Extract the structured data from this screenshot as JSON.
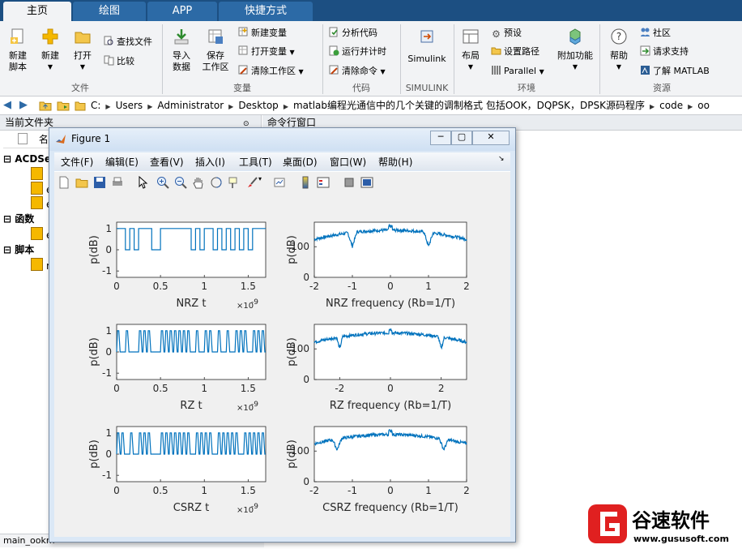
{
  "tabs": [
    {
      "label": "主页",
      "active": true
    },
    {
      "label": "绘图",
      "active": false
    },
    {
      "label": "APP",
      "active": false
    },
    {
      "label": "快捷方式",
      "active": false
    }
  ],
  "ribbon": {
    "new_script": "新建\n脚本",
    "new": "新建",
    "open": "打开",
    "find_files": "查找文件",
    "compare": "比较",
    "import_data": "导入\n数据",
    "save_workspace": "保存\n工作区",
    "new_variable": "新建变量",
    "open_variable": "打开变量",
    "clear_workspace": "清除工作区",
    "analyze_code": "分析代码",
    "run_and_time": "运行并计时",
    "clear_commands": "清除命令",
    "simulink": "Simulink",
    "layout": "布局",
    "preferences": "预设",
    "set_path": "设置路径",
    "parallel": "Parallel",
    "addons": "附加功能",
    "help": "帮助",
    "community": "社区",
    "request_support": "请求支持",
    "learn_matlab": "了解 MATLAB",
    "groups": [
      "文件",
      "变量",
      "代码",
      "SIMULINK",
      "环境",
      "资源"
    ]
  },
  "address": {
    "crumbs": [
      "C:",
      "Users",
      "Administrator",
      "Desktop",
      "matlab编程光通信中的几个关键的调制格式 包括OOK，DQPSK，DPSK源码程序",
      "code",
      "oo"
    ]
  },
  "current_folder": {
    "title": "当前文件夹",
    "name_column": "名",
    "sections": [
      {
        "label": "ACDSe",
        "items": [
          "",
          "e",
          "e"
        ]
      },
      {
        "label": "函数",
        "items": [
          "e"
        ]
      },
      {
        "label": "脚本",
        "items": [
          "m"
        ]
      }
    ],
    "status": "main_ookm"
  },
  "command_window": {
    "title": "命令行窗口"
  },
  "figure": {
    "title": "Figure 1",
    "menus": [
      "文件(F)",
      "编辑(E)",
      "查看(V)",
      "插入(I)",
      "工具(T)",
      "桌面(D)",
      "窗口(W)",
      "帮助(H)"
    ],
    "axes_common": {
      "ylabel": "p(dB)",
      "exponent": "×10",
      "exponent_power": "-9"
    }
  },
  "chart_data": [
    {
      "type": "line",
      "row": 0,
      "col": 0,
      "title": "",
      "xlabel": "NRZ   t",
      "ylabel": "p(dB)",
      "xlim": [
        0,
        1.7
      ],
      "ylim": [
        -1.3,
        1.3
      ],
      "xticks": [
        0,
        0.5,
        1,
        1.5
      ],
      "xtick_labels": [
        "0",
        "0.5",
        "1",
        "1.5"
      ],
      "yticks": [
        -1,
        0,
        1
      ],
      "ytick_labels": [
        "-1",
        "0",
        "1"
      ],
      "exponent": "-9",
      "waveform": {
        "kind": "nrz",
        "bits": [
          1,
          1,
          0,
          1,
          0,
          1,
          1,
          1,
          0,
          0,
          1,
          1,
          1,
          1,
          1,
          1,
          1,
          0,
          1,
          0,
          1,
          1,
          0,
          1,
          0,
          1,
          0,
          1,
          0,
          1,
          0,
          1,
          1,
          1
        ]
      }
    },
    {
      "type": "line",
      "row": 0,
      "col": 1,
      "title": "",
      "xlabel": "NRZ   frequency (Rb=1/T)",
      "ylabel": "p(dB)",
      "xlim": [
        -2,
        2
      ],
      "ylim": [
        0,
        180
      ],
      "xticks": [
        -2,
        -1,
        0,
        1,
        2
      ],
      "xtick_labels": [
        "-2",
        "-1",
        "0",
        "1",
        "2"
      ],
      "yticks": [
        0,
        100
      ],
      "ytick_labels": [
        "0",
        "100"
      ],
      "spectrum": {
        "nulls": [
          -1,
          1
        ],
        "peak": 160,
        "null_depth": 130
      }
    },
    {
      "type": "line",
      "row": 1,
      "col": 0,
      "title": "",
      "xlabel": "RZ   t",
      "ylabel": "p(dB)",
      "xlim": [
        0,
        1.7
      ],
      "ylim": [
        -1.3,
        1.3
      ],
      "xticks": [
        0,
        0.5,
        1,
        1.5
      ],
      "xtick_labels": [
        "0",
        "0.5",
        "1",
        "1.5"
      ],
      "yticks": [
        -1,
        0,
        1
      ],
      "ytick_labels": [
        "-1",
        "0",
        "1"
      ],
      "exponent": "-9",
      "waveform": {
        "kind": "rz",
        "bits": [
          1,
          0,
          1,
          0,
          0,
          1,
          1,
          1,
          0,
          0,
          1,
          1,
          1,
          1,
          1,
          1,
          1,
          0,
          1,
          0,
          1,
          1,
          0,
          1,
          0,
          1,
          0,
          1,
          1,
          1,
          0,
          1,
          1,
          1
        ]
      }
    },
    {
      "type": "line",
      "row": 1,
      "col": 1,
      "title": "",
      "xlabel": "RZ   frequency (Rb=1/T)",
      "ylabel": "p(dB)",
      "xlim": [
        -3,
        3
      ],
      "ylim": [
        0,
        180
      ],
      "xticks": [
        -2,
        0,
        2
      ],
      "xtick_labels": [
        "-2",
        "0",
        "2"
      ],
      "yticks": [
        0,
        100
      ],
      "ytick_labels": [
        "0",
        "100"
      ],
      "spectrum": {
        "nulls": [
          -2,
          2
        ],
        "peak": 158,
        "null_depth": 110
      }
    },
    {
      "type": "line",
      "row": 2,
      "col": 0,
      "title": "",
      "xlabel": "CSRZ   t",
      "ylabel": "p(dB)",
      "xlim": [
        0,
        1.7
      ],
      "ylim": [
        -1.3,
        1.3
      ],
      "xticks": [
        0,
        0.5,
        1,
        1.5
      ],
      "xtick_labels": [
        "0",
        "0.5",
        "1",
        "1.5"
      ],
      "yticks": [
        -1,
        0,
        1
      ],
      "ytick_labels": [
        "-1",
        "0",
        "1"
      ],
      "exponent": "-9",
      "waveform": {
        "kind": "rz",
        "bits": [
          1,
          1,
          0,
          1,
          0,
          1,
          1,
          1,
          0,
          0,
          1,
          1,
          1,
          1,
          1,
          1,
          1,
          0,
          1,
          1,
          1,
          1,
          0,
          1,
          1,
          1,
          1,
          1,
          0,
          1,
          1,
          1,
          1,
          1
        ]
      }
    },
    {
      "type": "line",
      "row": 2,
      "col": 1,
      "title": "",
      "xlabel": "CSRZ   frequency (Rb=1/T)",
      "ylabel": "p(dB)",
      "xlim": [
        -2,
        2
      ],
      "ylim": [
        0,
        180
      ],
      "xticks": [
        -2,
        -1,
        0,
        1,
        2
      ],
      "xtick_labels": [
        "-2",
        "-1",
        "0",
        "1",
        "2"
      ],
      "yticks": [
        0,
        100
      ],
      "ytick_labels": [
        "0",
        "100"
      ],
      "spectrum": {
        "nulls": [
          -1.4,
          1.4
        ],
        "peak": 160,
        "null_depth": 100
      }
    }
  ],
  "colors": {
    "line": "#0072bd",
    "ribbon_bg": "#f2f3f5",
    "tab_bar": "#1c4f82",
    "watermark_red": "#e02020"
  },
  "watermark": {
    "brand": "谷速软件",
    "url": "www.gususoft.com"
  }
}
